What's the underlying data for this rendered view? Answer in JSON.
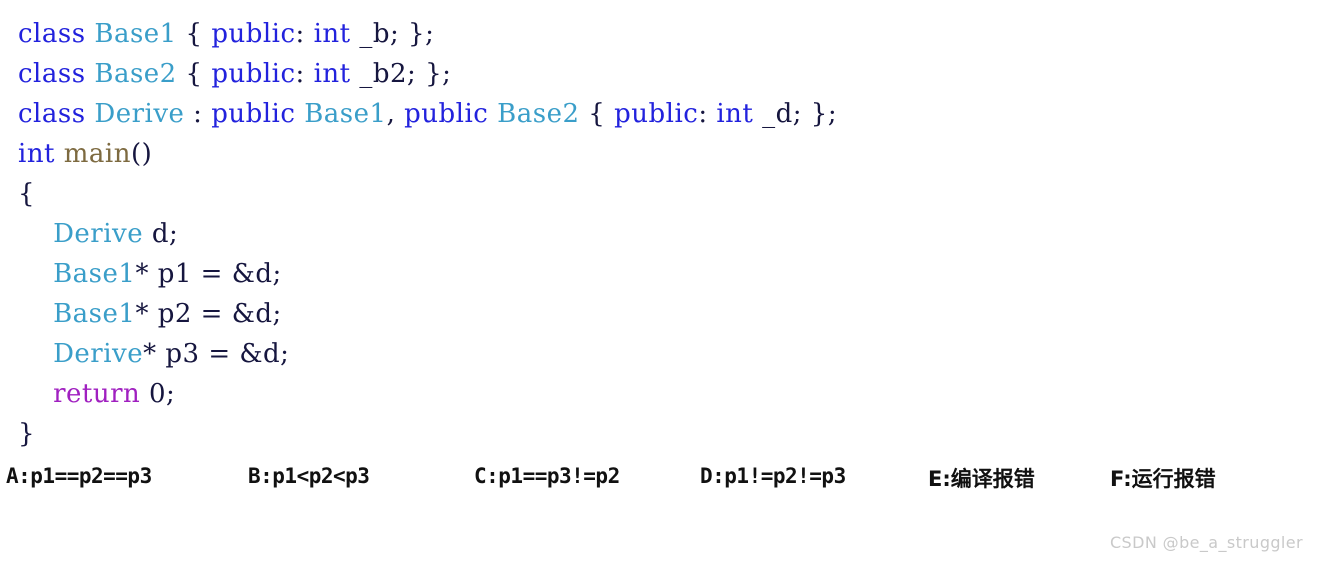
{
  "code": {
    "language": "cpp",
    "colors": {
      "keyword": "#2222dd",
      "type_name": "#3a9ec9",
      "function_name": "#7d6a40",
      "return_keyword": "#a020c0",
      "plain_text": "#16163f",
      "background": "#ffffff"
    },
    "lines": [
      {
        "index": 1,
        "text": "class Base1 { public: int _b; };",
        "tokens": [
          {
            "t": "class",
            "c": "kw"
          },
          {
            "t": " ",
            "c": "plain"
          },
          {
            "t": "Base1",
            "c": "type"
          },
          {
            "t": " ",
            "c": "plain"
          },
          {
            "t": "{",
            "c": "punc"
          },
          {
            "t": " ",
            "c": "plain"
          },
          {
            "t": "public",
            "c": "kw"
          },
          {
            "t": ":",
            "c": "punc"
          },
          {
            "t": " ",
            "c": "plain"
          },
          {
            "t": "int",
            "c": "kw"
          },
          {
            "t": " ",
            "c": "plain"
          },
          {
            "t": "_b; };",
            "c": "plain"
          }
        ]
      },
      {
        "index": 2,
        "text": "class Base2 { public: int _b2; };",
        "tokens": [
          {
            "t": "class",
            "c": "kw"
          },
          {
            "t": " ",
            "c": "plain"
          },
          {
            "t": "Base2",
            "c": "type"
          },
          {
            "t": " ",
            "c": "plain"
          },
          {
            "t": "{",
            "c": "punc"
          },
          {
            "t": " ",
            "c": "plain"
          },
          {
            "t": "public",
            "c": "kw"
          },
          {
            "t": ":",
            "c": "punc"
          },
          {
            "t": " ",
            "c": "plain"
          },
          {
            "t": "int",
            "c": "kw"
          },
          {
            "t": " ",
            "c": "plain"
          },
          {
            "t": "_b2; };",
            "c": "plain"
          }
        ]
      },
      {
        "index": 3,
        "text": "class Derive : public Base1, public Base2 { public: int _d; };",
        "tokens": [
          {
            "t": "class",
            "c": "kw"
          },
          {
            "t": " ",
            "c": "plain"
          },
          {
            "t": "Derive",
            "c": "type"
          },
          {
            "t": " : ",
            "c": "punc"
          },
          {
            "t": "public",
            "c": "kw"
          },
          {
            "t": " ",
            "c": "plain"
          },
          {
            "t": "Base1",
            "c": "type"
          },
          {
            "t": ", ",
            "c": "punc"
          },
          {
            "t": "public",
            "c": "kw"
          },
          {
            "t": " ",
            "c": "plain"
          },
          {
            "t": "Base2",
            "c": "type"
          },
          {
            "t": " ",
            "c": "plain"
          },
          {
            "t": "{",
            "c": "punc"
          },
          {
            "t": " ",
            "c": "plain"
          },
          {
            "t": "public",
            "c": "kw"
          },
          {
            "t": ":",
            "c": "punc"
          },
          {
            "t": " ",
            "c": "plain"
          },
          {
            "t": "int",
            "c": "kw"
          },
          {
            "t": " ",
            "c": "plain"
          },
          {
            "t": "_d; };",
            "c": "plain"
          }
        ]
      },
      {
        "index": 4,
        "text": "int main()",
        "tokens": [
          {
            "t": "int",
            "c": "kw"
          },
          {
            "t": " ",
            "c": "plain"
          },
          {
            "t": "main",
            "c": "fn"
          },
          {
            "t": "()",
            "c": "punc"
          }
        ]
      },
      {
        "index": 5,
        "text": "{",
        "tokens": [
          {
            "t": "{",
            "c": "punc"
          }
        ]
      },
      {
        "index": 6,
        "text": "    Derive d;",
        "tokens": [
          {
            "t": "    ",
            "c": "plain"
          },
          {
            "t": "Derive",
            "c": "type"
          },
          {
            "t": " d;",
            "c": "plain"
          }
        ]
      },
      {
        "index": 7,
        "text": "    Base1* p1 = &d;",
        "tokens": [
          {
            "t": "    ",
            "c": "plain"
          },
          {
            "t": "Base1",
            "c": "type"
          },
          {
            "t": "* p1 = &d;",
            "c": "plain"
          }
        ]
      },
      {
        "index": 8,
        "text": "    Base1* p2 = &d;",
        "tokens": [
          {
            "t": "    ",
            "c": "plain"
          },
          {
            "t": "Base1",
            "c": "type"
          },
          {
            "t": "* p2 = &d;",
            "c": "plain"
          }
        ]
      },
      {
        "index": 9,
        "text": "    Derive* p3 = &d;",
        "tokens": [
          {
            "t": "    ",
            "c": "plain"
          },
          {
            "t": "Derive",
            "c": "type"
          },
          {
            "t": "* p3 = &d;",
            "c": "plain"
          }
        ]
      },
      {
        "index": 10,
        "text": "    return 0;",
        "tokens": [
          {
            "t": "    ",
            "c": "plain"
          },
          {
            "t": "return",
            "c": "ret"
          },
          {
            "t": " 0;",
            "c": "plain"
          }
        ]
      },
      {
        "index": 11,
        "text": "}",
        "tokens": [
          {
            "t": "}",
            "c": "punc"
          }
        ]
      }
    ]
  },
  "options": {
    "a": "A:p1==p2==p3",
    "b": "B:p1<p2<p3",
    "c": "C:p1==p3!=p2",
    "d": "D:p1!=p2!=p3",
    "e": "E:编译报错",
    "f": "F:运行报错"
  },
  "watermark": {
    "text": "CSDN @be_a_struggler",
    "color": "#c9c9c9"
  }
}
